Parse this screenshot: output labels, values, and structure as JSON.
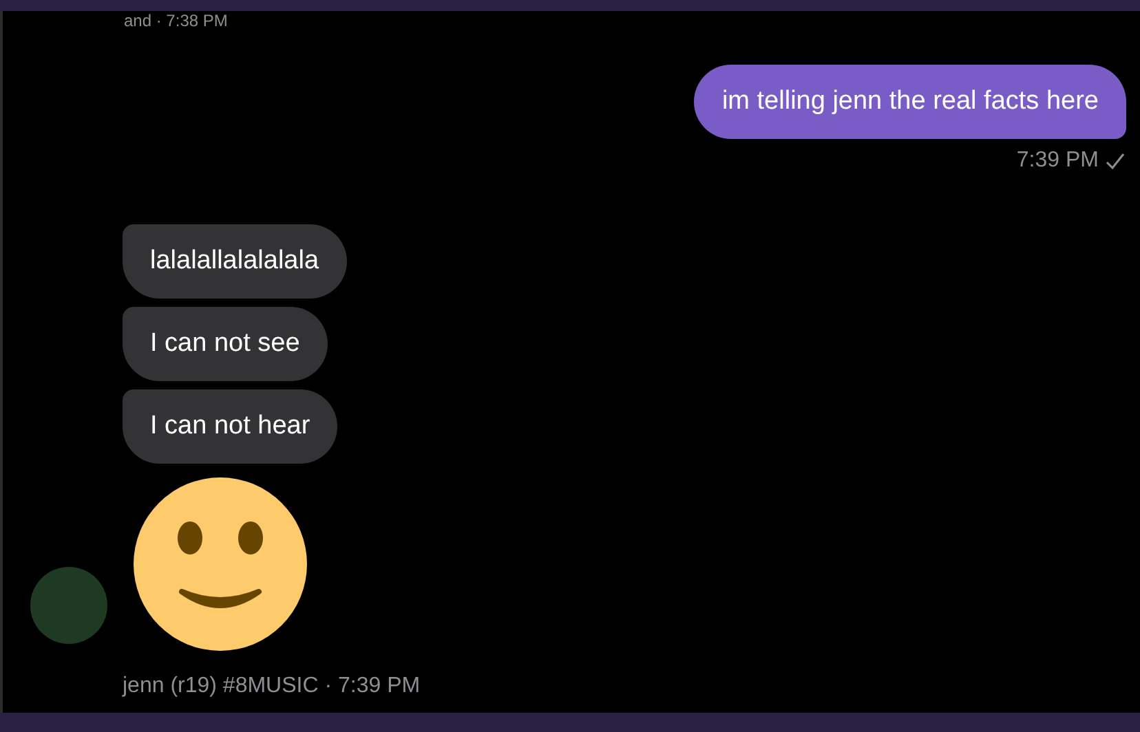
{
  "earlier_meta": "and · 7:38 PM",
  "outgoing": {
    "text": "im telling jenn the real facts here",
    "time": "7:39 PM",
    "delivered": true
  },
  "incoming": {
    "messages": [
      {
        "kind": "text",
        "text": "lalalallalalalala"
      },
      {
        "kind": "text",
        "text": "I can not see"
      },
      {
        "kind": "text",
        "text": "I can not hear"
      },
      {
        "kind": "emoji"
      }
    ],
    "sender_line": "jenn (r19) #8MUSIC · 7:39 PM"
  }
}
